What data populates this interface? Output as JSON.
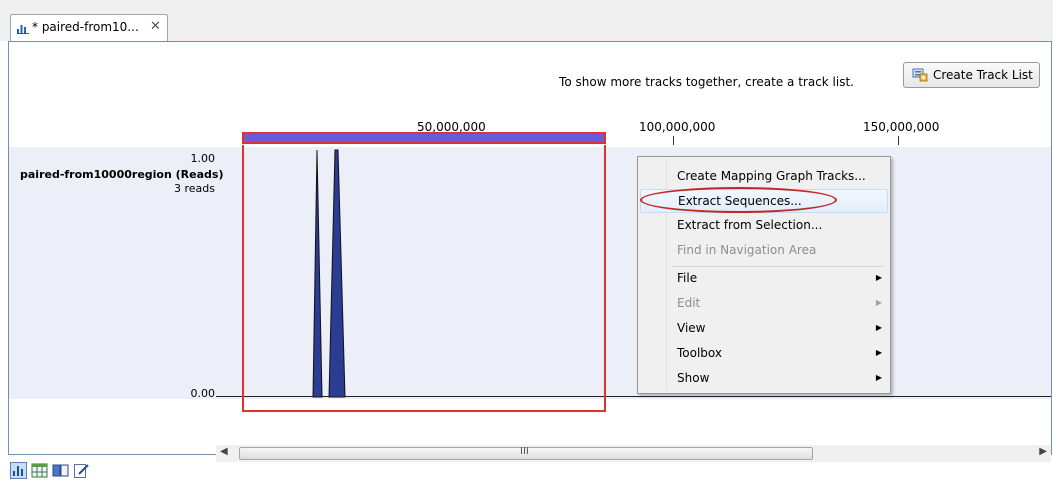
{
  "tab": {
    "label": "* paired-from10...",
    "close": "✕"
  },
  "toolbar": {
    "hint": "To show more tracks together, create a track list.",
    "create_track_list": "Create Track List"
  },
  "ruler": {
    "labels": [
      "50,000,000",
      "100,000,000",
      "150,000,000"
    ]
  },
  "track": {
    "name": "paired-from10000region (Reads)",
    "count": "3 reads",
    "y_max": "1.00",
    "y_min": "0.00"
  },
  "scrollbar": {
    "left_arrow": "◀",
    "right_arrow": "▶",
    "grip": "III"
  },
  "context_menu": {
    "items": [
      {
        "label": "Create Mapping Graph Tracks...",
        "enabled": true
      },
      {
        "label": "Extract Sequences...",
        "enabled": true,
        "highlighted": true,
        "annotated": true
      },
      {
        "label": "Extract from Selection...",
        "enabled": true
      },
      {
        "label": "Find in Navigation Area",
        "enabled": false
      },
      {
        "label": "File",
        "enabled": true,
        "submenu": true
      },
      {
        "label": "Edit",
        "enabled": false,
        "submenu": true
      },
      {
        "label": "View",
        "enabled": true,
        "submenu": true
      },
      {
        "label": "Toolbox",
        "enabled": true,
        "submenu": true
      },
      {
        "label": "Show",
        "enabled": true,
        "submenu": true
      }
    ],
    "submenu_arrow": "▶"
  },
  "view_icons": [
    "graph-view-icon",
    "table-view-icon",
    "history-icon",
    "edit-icon"
  ],
  "colors": {
    "selection_bar": "#6b5bd8",
    "selection_border": "#e03030",
    "graph_fill": "#2b3d93",
    "track_bg": "#eceef8",
    "annotation": "#c2282a"
  }
}
